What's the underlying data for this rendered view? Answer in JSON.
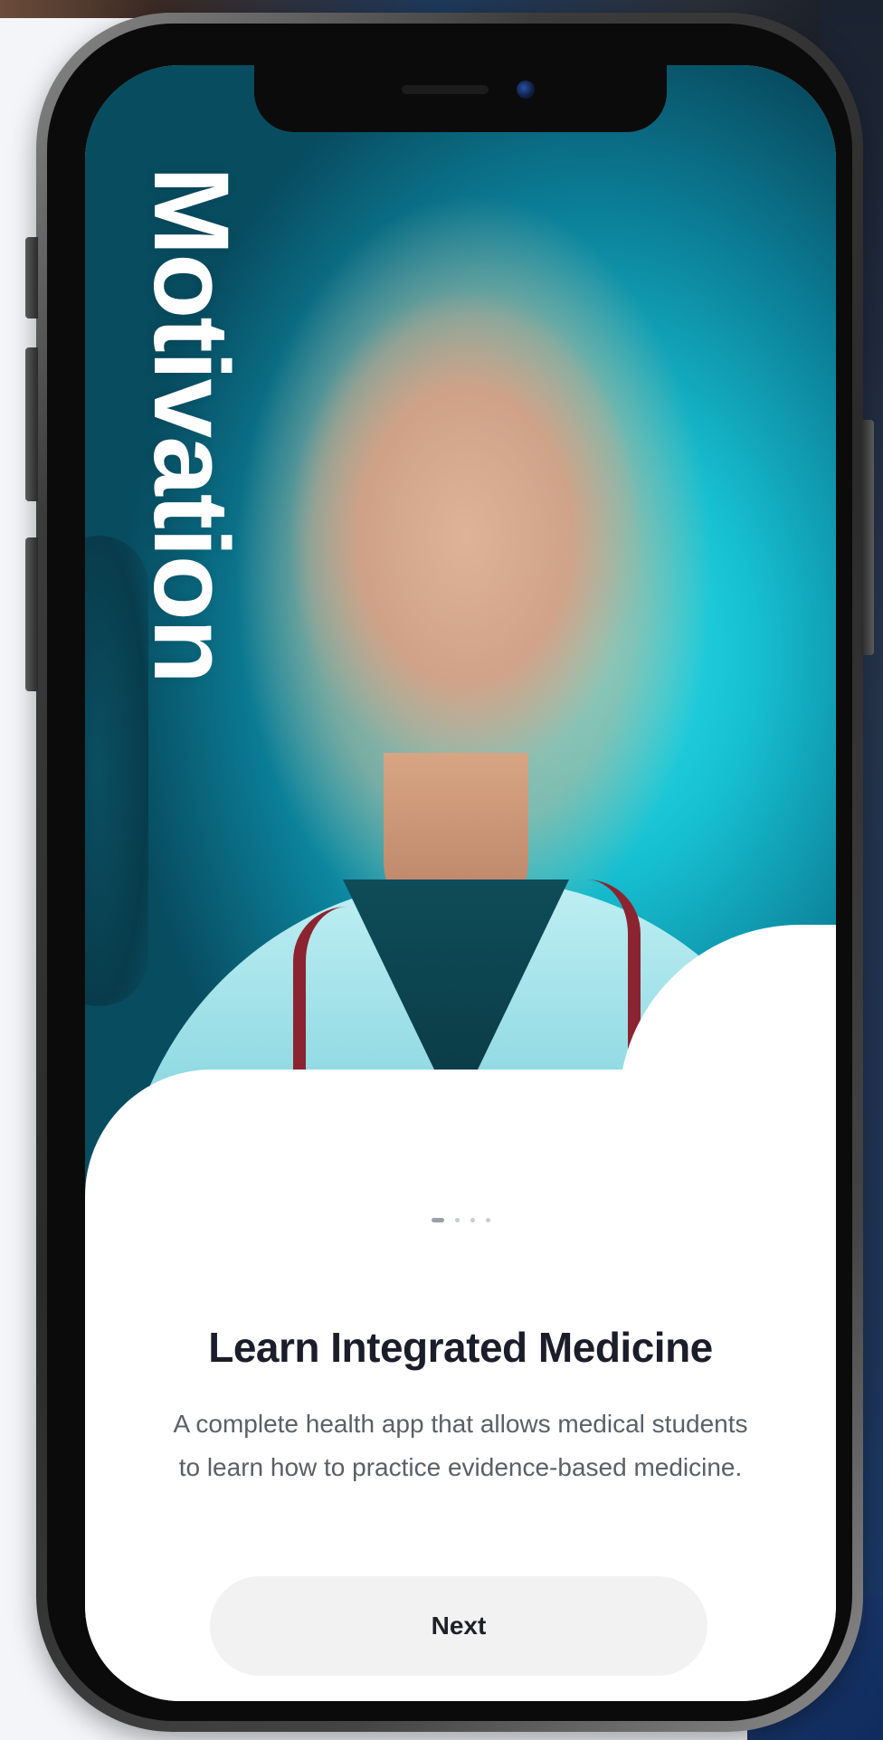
{
  "screen": {
    "vertical_title": "Motivation",
    "pager": {
      "total": 4,
      "active_index": 0
    },
    "onboarding": {
      "title": "Learn Integrated Medicine",
      "description": "A complete health app that allows medical students to learn how to practice evidence-based medicine.",
      "next_label": "Next"
    }
  },
  "colors": {
    "accent_teal": "#16bfd0",
    "title_text": "#1b1d2a",
    "body_text": "#5b5f66",
    "button_bg": "#f2f2f3"
  },
  "icons": {
    "camera": "front-camera-icon",
    "speaker": "earpiece-speaker-icon"
  }
}
